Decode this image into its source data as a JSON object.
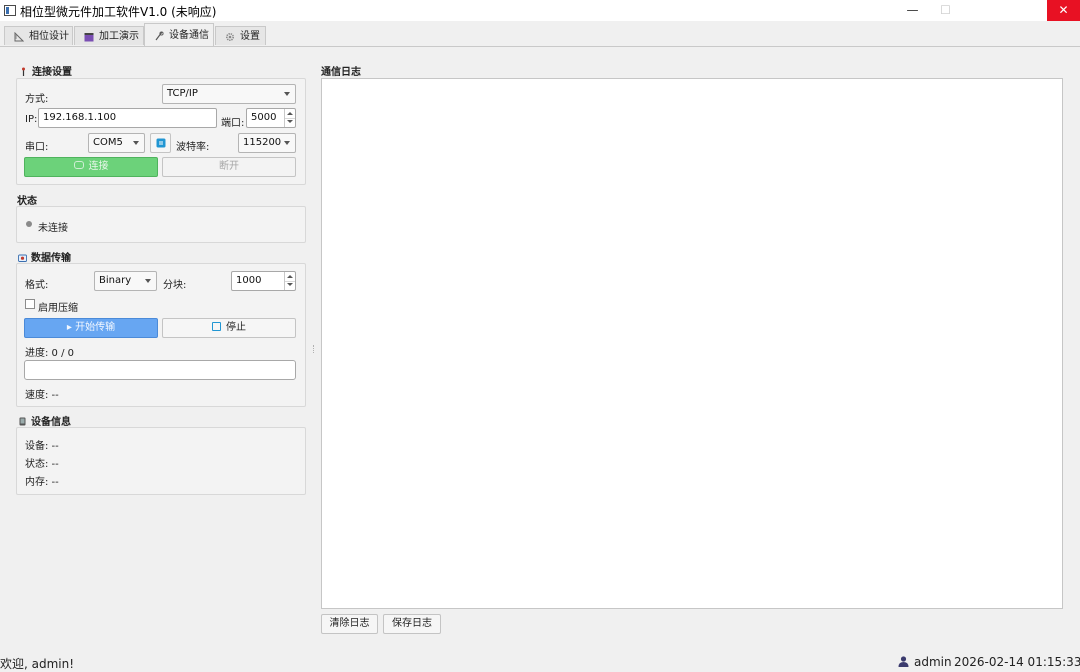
{
  "window": {
    "title": "相位型微元件加工软件V1.0 (未响应)",
    "min_glyph": "—",
    "max_glyph": "☐",
    "close_glyph": "✕"
  },
  "tabs": [
    {
      "label": "相位设计",
      "icon": "ruler-icon",
      "active": false
    },
    {
      "label": "加工演示",
      "icon": "clapper-icon",
      "active": false
    },
    {
      "label": "设备通信",
      "icon": "satellite-icon",
      "active": true
    },
    {
      "label": "设置",
      "icon": "gear-icon",
      "active": false
    }
  ],
  "connection": {
    "title": "连接设置",
    "mode_label": "方式:",
    "mode_value": "TCP/IP",
    "ip_label": "IP:",
    "ip_value": "192.168.1.100",
    "port_label": "端口:",
    "port_value": "5000",
    "serial_label": "串口:",
    "serial_value": "COM5",
    "baud_label": "波特率:",
    "baud_value": "115200",
    "connect_label": "连接",
    "disconnect_label": "断开"
  },
  "status": {
    "title": "状态",
    "value": "未连接"
  },
  "transfer": {
    "title": "数据传输",
    "format_label": "格式:",
    "format_value": "Binary",
    "chunk_label": "分块:",
    "chunk_value": "1000",
    "compress_label": "启用压缩",
    "compress_checked": false,
    "start_label": "▸ 开始传输",
    "stop_label": "停止",
    "progress_text": "进度: 0 / 0",
    "progress_fraction": 0,
    "speed_text": "速度: --"
  },
  "device_info": {
    "title": "设备信息",
    "device": "设备: --",
    "state": "状态: --",
    "memory": "内存: --"
  },
  "log": {
    "title": "通信日志",
    "clear_label": "清除日志",
    "save_label": "保存日志"
  },
  "statusbar": {
    "welcome": "欢迎, admin!",
    "user": "admin",
    "datetime": "2026-02-14 01:15:33"
  },
  "colors": {
    "connect_button": "#6cd27a",
    "start_button": "#67a6f2",
    "close_button": "#e81123"
  }
}
